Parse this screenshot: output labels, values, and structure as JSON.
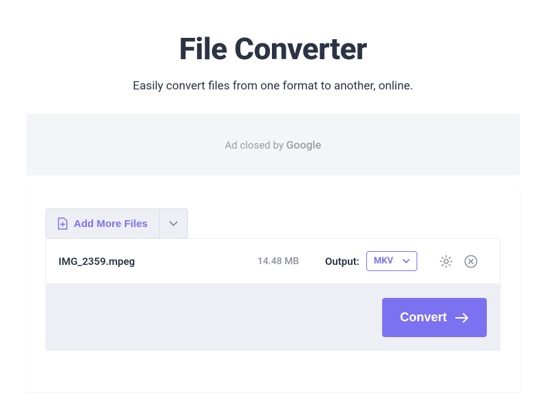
{
  "header": {
    "title": "File Converter",
    "subtitle": "Easily convert files from one format to another, online."
  },
  "ad": {
    "text_prefix": "Ad closed by ",
    "brand": "Google"
  },
  "toolbar": {
    "add_more_label": "Add More Files"
  },
  "file": {
    "name": "IMG_2359.mpeg",
    "size": "14.48 MB",
    "output_label": "Output:",
    "selected_format": "MKV"
  },
  "actions": {
    "convert_label": "Convert"
  }
}
